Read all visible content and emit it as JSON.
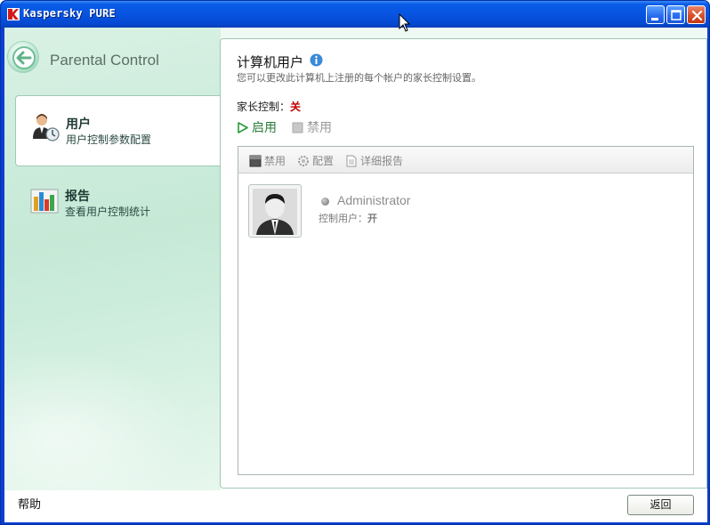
{
  "window": {
    "title": "Kaspersky PURE",
    "colors": {
      "titlebar": "#0754e0",
      "close": "#d8502a",
      "accent_green": "#2a7a3a",
      "status_red": "#c00000"
    }
  },
  "sidebar": {
    "section_title": "Parental Control",
    "items": [
      {
        "label": "用户",
        "sub": "用户控制参数配置",
        "icon": "users-icon",
        "active": true
      },
      {
        "label": "报告",
        "sub": "查看用户控制统计",
        "icon": "report-chart-icon",
        "active": false
      }
    ],
    "help": "帮助"
  },
  "main": {
    "title": "计算机用户",
    "description": "您可以更改此计算机上注册的每个帐户的家长控制设置。",
    "status_label": "家长控制：",
    "status_value": "关",
    "enable_label": "启用",
    "disable_label": "禁用",
    "toolbar": {
      "disable": "禁用",
      "configure": "配置",
      "report": "详细报告"
    },
    "users": [
      {
        "name": "Administrator",
        "control_label": "控制用户：",
        "control_value": "开"
      }
    ]
  },
  "footer": {
    "return_label": "返回"
  }
}
